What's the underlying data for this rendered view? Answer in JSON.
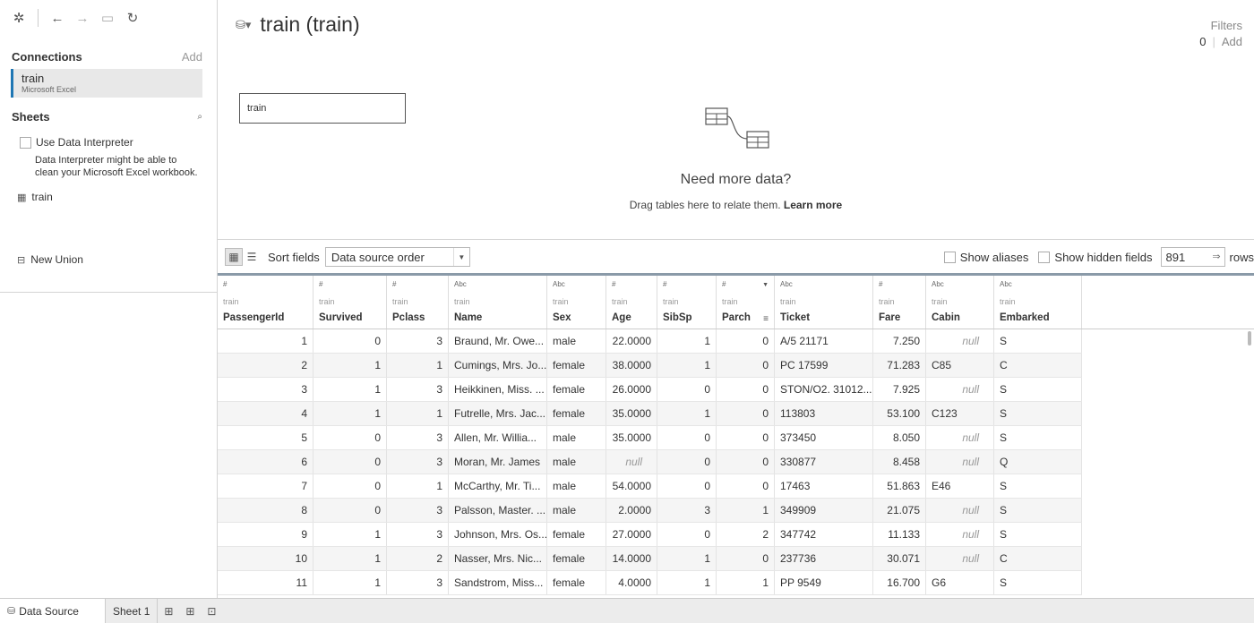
{
  "toolbar": {
    "icons": [
      "tableau-logo-icon",
      "back-icon",
      "forward-icon",
      "save-icon",
      "refresh-icon"
    ]
  },
  "connections": {
    "title": "Connections",
    "add_label": "Add",
    "items": [
      {
        "name": "train",
        "type": "Microsoft Excel"
      }
    ]
  },
  "sheets": {
    "title": "Sheets",
    "data_interpreter_label": "Use Data Interpreter",
    "data_interpreter_desc": "Data Interpreter might be able to clean your Microsoft Excel workbook.",
    "items": [
      {
        "name": "train"
      }
    ],
    "new_union_label": "New Union"
  },
  "canvas": {
    "title": "train (train)",
    "filters_label": "Filters",
    "filters_count": "0",
    "filters_add": "Add",
    "table_name": "train",
    "need_more_data": "Need more data?",
    "drag_text": "Drag tables here to relate them.",
    "learn_more": "Learn more"
  },
  "gridbar": {
    "sort_label": "Sort fields",
    "sort_value": "Data source order",
    "show_aliases": "Show aliases",
    "show_hidden": "Show hidden fields",
    "rows_value": "891",
    "rows_label": "rows"
  },
  "grid": {
    "columns": [
      {
        "type": "#",
        "source": "train",
        "name": "PassengerId"
      },
      {
        "type": "#",
        "source": "train",
        "name": "Survived"
      },
      {
        "type": "#",
        "source": "train",
        "name": "Pclass"
      },
      {
        "type": "Abc",
        "source": "train",
        "name": "Name"
      },
      {
        "type": "Abc",
        "source": "train",
        "name": "Sex"
      },
      {
        "type": "#",
        "source": "train",
        "name": "Age"
      },
      {
        "type": "#",
        "source": "train",
        "name": "SibSp"
      },
      {
        "type": "#",
        "source": "train",
        "name": "Parch"
      },
      {
        "type": "Abc",
        "source": "train",
        "name": "Ticket"
      },
      {
        "type": "#",
        "source": "train",
        "name": "Fare"
      },
      {
        "type": "Abc",
        "source": "train",
        "name": "Cabin"
      },
      {
        "type": "Abc",
        "source": "train",
        "name": "Embarked"
      }
    ],
    "rows": [
      [
        "1",
        "0",
        "3",
        "Braund, Mr. Owe...",
        "male",
        "22.0000",
        "1",
        "0",
        "A/5 21171",
        "7.250",
        "null",
        "S"
      ],
      [
        "2",
        "1",
        "1",
        "Cumings, Mrs. Jo...",
        "female",
        "38.0000",
        "1",
        "0",
        "PC 17599",
        "71.283",
        "C85",
        "C"
      ],
      [
        "3",
        "1",
        "3",
        "Heikkinen, Miss. ...",
        "female",
        "26.0000",
        "0",
        "0",
        "STON/O2. 31012...",
        "7.925",
        "null",
        "S"
      ],
      [
        "4",
        "1",
        "1",
        "Futrelle, Mrs. Jac...",
        "female",
        "35.0000",
        "1",
        "0",
        "113803",
        "53.100",
        "C123",
        "S"
      ],
      [
        "5",
        "0",
        "3",
        "Allen, Mr. Willia...",
        "male",
        "35.0000",
        "0",
        "0",
        "373450",
        "8.050",
        "null",
        "S"
      ],
      [
        "6",
        "0",
        "3",
        "Moran, Mr. James",
        "male",
        "null",
        "0",
        "0",
        "330877",
        "8.458",
        "null",
        "Q"
      ],
      [
        "7",
        "0",
        "1",
        "McCarthy, Mr. Ti...",
        "male",
        "54.0000",
        "0",
        "0",
        "17463",
        "51.863",
        "E46",
        "S"
      ],
      [
        "8",
        "0",
        "3",
        "Palsson, Master. ...",
        "male",
        "2.0000",
        "3",
        "1",
        "349909",
        "21.075",
        "null",
        "S"
      ],
      [
        "9",
        "1",
        "3",
        "Johnson, Mrs. Os...",
        "female",
        "27.0000",
        "0",
        "2",
        "347742",
        "11.133",
        "null",
        "S"
      ],
      [
        "10",
        "1",
        "2",
        "Nasser, Mrs. Nic...",
        "female",
        "14.0000",
        "1",
        "0",
        "237736",
        "30.071",
        "null",
        "C"
      ],
      [
        "11",
        "1",
        "3",
        "Sandstrom, Miss...",
        "female",
        "4.0000",
        "1",
        "1",
        "PP 9549",
        "16.700",
        "G6",
        "S"
      ]
    ]
  },
  "tabs": {
    "data_source": "Data Source",
    "sheet1": "Sheet 1"
  },
  "colors": {
    "accent": "#1f77b4",
    "header_border": "#8a9aa8"
  }
}
